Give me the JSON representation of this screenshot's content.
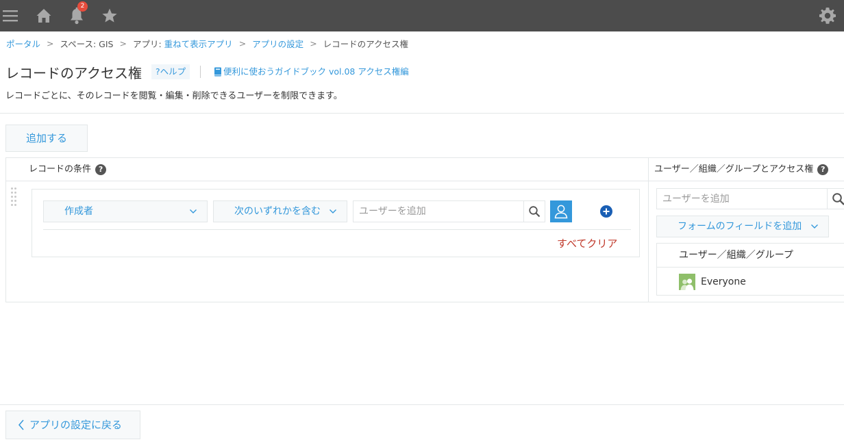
{
  "topbar": {
    "icons": [
      "menu-icon",
      "home-icon",
      "bell-icon",
      "star-icon",
      "gear-icon"
    ],
    "notification_count": "2",
    "background": "#4c4c4c",
    "badge_color": "#e74c3c"
  },
  "breadcrumb": {
    "items": [
      {
        "label": "ポータル",
        "link": true
      },
      {
        "label": "スペース: GIS",
        "link": false
      },
      {
        "label": "アプリ: ",
        "link": false
      },
      {
        "label": "重ねて表示アプリ",
        "link": true
      },
      {
        "label": "アプリの設定",
        "link": true
      },
      {
        "label": "レコードのアクセス権",
        "link": false
      }
    ],
    "separator": ">"
  },
  "header": {
    "title": "レコードのアクセス権",
    "help_label": "?ヘルプ",
    "guide_label": "便利に使おうガイドブック vol.08 アクセス権編",
    "description": "レコードごとに、そのレコードを閲覧・編集・削除できるユーザーを制限できます。"
  },
  "actions": {
    "add_label": "追加する",
    "back_label": "アプリの設定に戻る"
  },
  "table": {
    "condition_header": "レコードの条件",
    "access_header": "ユーザー／組織／グループとアクセス権",
    "condition": {
      "field_label": "作成者",
      "operator_label": "次のいずれかを含む",
      "user_placeholder": "ユーザーを追加",
      "clear_all_label": "すべてクリア"
    },
    "access": {
      "user_placeholder": "ユーザーを追加",
      "form_field_label": "フォームのフィールドを追加",
      "list_header": "ユーザー／組織／グループ",
      "entries": [
        {
          "name": "Everyone"
        }
      ]
    }
  },
  "colors": {
    "accent": "#3498db",
    "clear_red": "#c0392b",
    "add_blue": "#1a5fb4",
    "everyone_green": "#8fbf6a"
  }
}
